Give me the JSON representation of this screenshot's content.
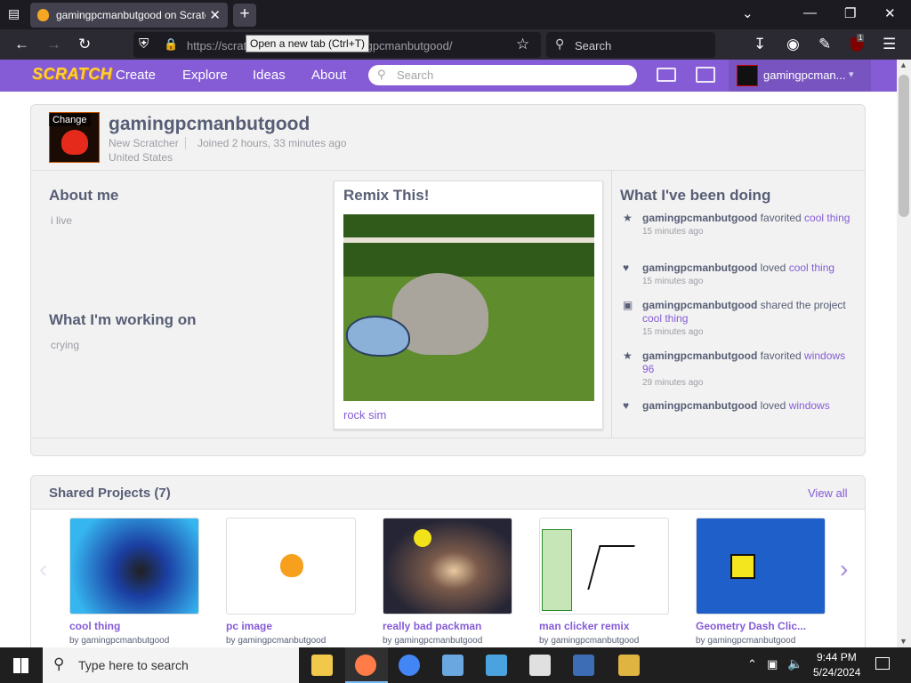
{
  "browser": {
    "tab_title": "gamingpcmanbutgood on Scratch",
    "url": "https://scratch.mit.edu/users/gamingpcmanbutgood/",
    "search_placeholder": "Search",
    "tooltip": "Open a new tab (Ctrl+T)",
    "extension_badge": "1"
  },
  "scratch_nav": {
    "logo": "SCRATCH",
    "create": "Create",
    "explore": "Explore",
    "ideas": "Ideas",
    "about": "About",
    "search_placeholder": "Search",
    "username": "gamingpcman..."
  },
  "profile": {
    "change_label": "Change",
    "username": "gamingpcmanbutgood",
    "rank": "New Scratcher",
    "joined": "Joined 2 hours, 33 minutes ago",
    "country": "United States"
  },
  "about": {
    "heading": "About me",
    "text": "i live",
    "working_heading": "What I'm working on",
    "working_text": "crying"
  },
  "featured": {
    "heading": "Remix This!",
    "project_title": "rock sim"
  },
  "activity": {
    "heading": "What I've been doing",
    "items": [
      {
        "user": "gamingpcmanbutgood",
        "action": "favorited",
        "target": "cool thing",
        "time": "15 minutes ago"
      },
      {
        "user": "gamingpcmanbutgood",
        "action": "loved",
        "target": "cool thing",
        "time": "15 minutes ago"
      },
      {
        "user": "gamingpcmanbutgood",
        "action": "shared the project",
        "target": "cool thing",
        "time": "15 minutes ago"
      },
      {
        "user": "gamingpcmanbutgood",
        "action": "favorited",
        "target": "windows 96",
        "time": "29 minutes ago"
      },
      {
        "user": "gamingpcmanbutgood",
        "action": "loved",
        "target": "windows",
        "time": ""
      }
    ]
  },
  "shared": {
    "heading": "Shared Projects (7)",
    "view_all": "View all",
    "projects": [
      {
        "title": "cool thing",
        "by": "by gamingpcmanbutgood"
      },
      {
        "title": "pc image",
        "by": "by gamingpcmanbutgood"
      },
      {
        "title": "really bad packman",
        "by": "by gamingpcmanbutgood"
      },
      {
        "title": "man clicker remix",
        "by": "by gamingpcmanbutgood"
      },
      {
        "title": "Geometry Dash Clic...",
        "by": "by gamingpcmanbutgood"
      }
    ]
  },
  "taskbar": {
    "search_placeholder": "Type here to search",
    "time": "9:44 PM",
    "date": "5/24/2024"
  },
  "colors": {
    "scratch_purple": "#855cd6",
    "text": "#575e75"
  }
}
